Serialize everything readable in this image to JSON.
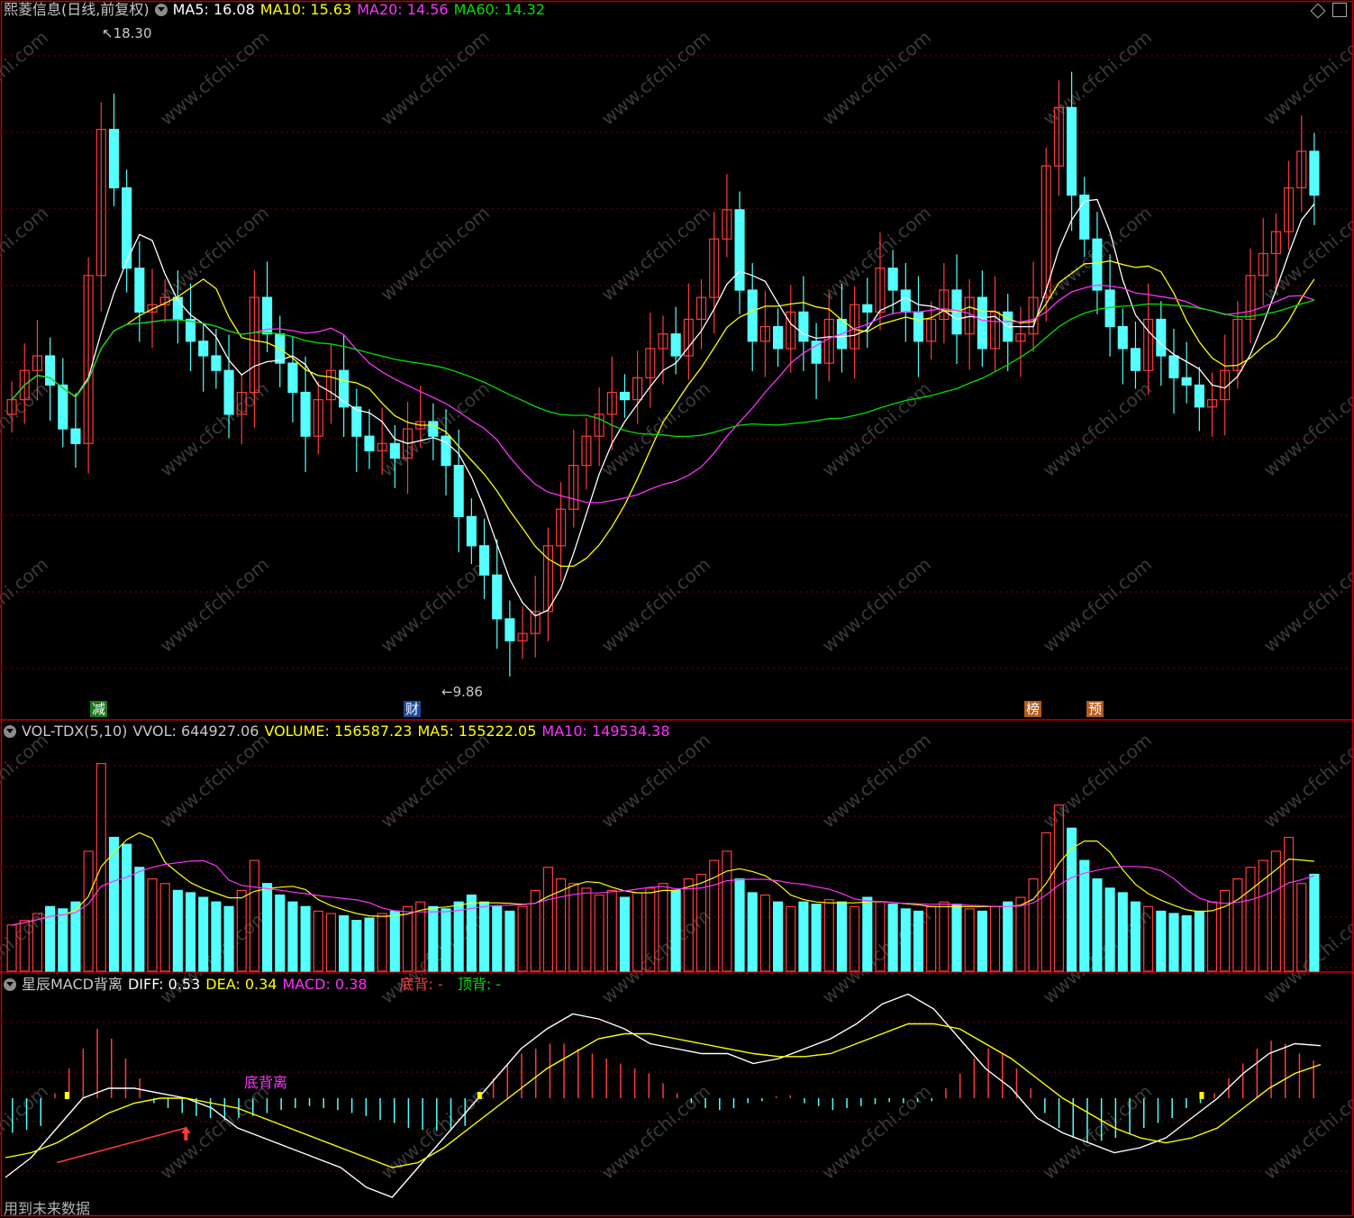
{
  "colors": {
    "up": "#ff3b3b",
    "down": "#54ffff",
    "ma5": "#ffffff",
    "ma10": "#ffff00",
    "ma20": "#ff30ff",
    "ma60": "#00e000",
    "grid": "#7a0000",
    "border": "#c00000",
    "label": "#c8c8c8",
    "watermark": "#3a3a3a"
  },
  "icons": [
    "dropdown-icon",
    "diamond-icon",
    "maximize-icon",
    "arrow-up-icon"
  ],
  "main_header": {
    "title": "熙菱信息(日线,前复权)",
    "ma5": "MA5: 16.08",
    "ma10": "MA10: 15.63",
    "ma20": "MA20: 14.56",
    "ma60": "MA60: 14.32"
  },
  "annotations": {
    "high": "18.30",
    "low": "9.86"
  },
  "event_marks": [
    "减",
    "财",
    "榜",
    "预"
  ],
  "vol_header": {
    "name": "VOL-TDX(5,10)",
    "vvol": "VVOL: 644927.06",
    "volume": "VOLUME: 156587.23",
    "ma5": "MA5: 155222.05",
    "ma10": "MA10: 149534.38"
  },
  "macd_header": {
    "name": "星辰MACD背离",
    "diff": "DIFF: 0.53",
    "dea": "DEA: 0.34",
    "macd": "MACD: 0.38",
    "bottom": "底背: -",
    "top": "顶背: -"
  },
  "divergence_label": "底背离",
  "footer": "用到未来数据",
  "watermark": "www.cfchi.com",
  "chart_data": {
    "type": "candlestick",
    "price_range": [
      9.5,
      18.7
    ],
    "price_high": 18.3,
    "price_low": 9.86,
    "candles_close": [
      13.5,
      13.9,
      14.1,
      13.7,
      13.1,
      12.9,
      15.2,
      17.2,
      16.4,
      15.3,
      14.7,
      14.8,
      14.9,
      14.6,
      14.3,
      14.1,
      13.9,
      13.3,
      13.6,
      14.9,
      14.4,
      14.0,
      13.6,
      13.0,
      13.5,
      13.9,
      13.4,
      13.0,
      12.8,
      12.9,
      12.7,
      13.1,
      13.2,
      13.0,
      12.6,
      11.9,
      11.5,
      11.1,
      10.5,
      10.2,
      10.3,
      10.6,
      11.5,
      12.0,
      12.6,
      13.0,
      13.3,
      13.6,
      13.5,
      13.8,
      14.2,
      14.4,
      14.1,
      14.6,
      14.9,
      15.7,
      16.1,
      15.0,
      14.3,
      14.5,
      14.2,
      14.7,
      14.3,
      14.0,
      14.6,
      14.2,
      14.8,
      14.7,
      15.3,
      15.0,
      14.7,
      14.3,
      14.6,
      15.0,
      14.4,
      14.9,
      14.2,
      14.7,
      14.3,
      14.4,
      14.9,
      16.7,
      17.5,
      16.3,
      15.7,
      15.0,
      14.5,
      14.2,
      13.9,
      14.6,
      14.1,
      13.8,
      13.7,
      13.4,
      13.5,
      13.9,
      14.6,
      15.2,
      15.5,
      15.8,
      16.4,
      16.9,
      16.3
    ],
    "ma_lines": [
      "MA5",
      "MA10",
      "MA20",
      "MA60"
    ],
    "volume": [
      20,
      22,
      25,
      28,
      27,
      30,
      52,
      90,
      58,
      55,
      45,
      40,
      38,
      35,
      34,
      32,
      30,
      28,
      35,
      48,
      38,
      33,
      30,
      28,
      26,
      25,
      24,
      22,
      23,
      25,
      26,
      28,
      30,
      28,
      27,
      30,
      33,
      30,
      28,
      26,
      28,
      35,
      45,
      40,
      38,
      36,
      33,
      35,
      32,
      34,
      36,
      38,
      35,
      40,
      42,
      48,
      52,
      40,
      34,
      33,
      30,
      28,
      30,
      29,
      31,
      30,
      28,
      32,
      30,
      29,
      27,
      26,
      28,
      30,
      29,
      27,
      26,
      28,
      30,
      32,
      40,
      60,
      72,
      62,
      48,
      40,
      36,
      34,
      30,
      28,
      26,
      25,
      24,
      26,
      30,
      35,
      40,
      45,
      48,
      52,
      58,
      38,
      42
    ],
    "macd_bars": [
      -0.35,
      -0.32,
      -0.28,
      0.05,
      0.3,
      0.5,
      0.7,
      0.6,
      0.4,
      0.2,
      -0.05,
      -0.1,
      -0.15,
      -0.18,
      -0.2,
      -0.22,
      -0.2,
      -0.18,
      -0.15,
      -0.12,
      -0.1,
      -0.08,
      -0.1,
      -0.12,
      -0.15,
      -0.18,
      -0.22,
      -0.25,
      -0.3,
      -0.32,
      -0.33,
      -0.32,
      -0.28,
      0.05,
      0.2,
      0.35,
      0.45,
      0.5,
      0.55,
      0.55,
      0.5,
      0.45,
      0.4,
      0.35,
      0.3,
      0.25,
      0.15,
      0.05,
      -0.05,
      -0.1,
      -0.12,
      -0.1,
      -0.05,
      -0.03,
      0.02,
      0.03,
      -0.05,
      -0.08,
      -0.12,
      -0.1,
      -0.08,
      -0.06,
      -0.04,
      -0.05,
      -0.04,
      -0.03,
      0.1,
      0.25,
      0.4,
      0.5,
      0.45,
      0.3,
      0.1,
      -0.15,
      -0.3,
      -0.4,
      -0.45,
      -0.43,
      -0.4,
      -0.36,
      -0.3,
      -0.25,
      -0.2,
      -0.1,
      -0.05,
      0.05,
      0.2,
      0.35,
      0.5,
      0.58,
      0.55,
      0.45,
      0.38
    ],
    "diff_line": [
      -0.8,
      -0.6,
      -0.3,
      0.0,
      0.1,
      0.1,
      0.05,
      0.0,
      -0.1,
      -0.3,
      -0.4,
      -0.5,
      -0.6,
      -0.7,
      -0.9,
      -1.0,
      -0.7,
      -0.4,
      -0.1,
      0.2,
      0.5,
      0.7,
      0.85,
      0.8,
      0.7,
      0.55,
      0.5,
      0.45,
      0.45,
      0.35,
      0.4,
      0.5,
      0.6,
      0.75,
      0.95,
      1.05,
      0.9,
      0.6,
      0.3,
      0.1,
      -0.2,
      -0.35,
      -0.45,
      -0.55,
      -0.5,
      -0.4,
      -0.2,
      0.0,
      0.25,
      0.45,
      0.55,
      0.53
    ],
    "dea_line": [
      -0.6,
      -0.55,
      -0.45,
      -0.3,
      -0.15,
      -0.05,
      0.0,
      0.0,
      -0.05,
      -0.1,
      -0.2,
      -0.3,
      -0.4,
      -0.5,
      -0.6,
      -0.7,
      -0.65,
      -0.5,
      -0.3,
      -0.1,
      0.1,
      0.3,
      0.45,
      0.6,
      0.65,
      0.65,
      0.6,
      0.55,
      0.5,
      0.45,
      0.42,
      0.42,
      0.45,
      0.55,
      0.65,
      0.75,
      0.75,
      0.7,
      0.55,
      0.4,
      0.2,
      0.0,
      -0.15,
      -0.3,
      -0.4,
      -0.45,
      -0.4,
      -0.3,
      -0.1,
      0.1,
      0.25,
      0.34
    ]
  }
}
